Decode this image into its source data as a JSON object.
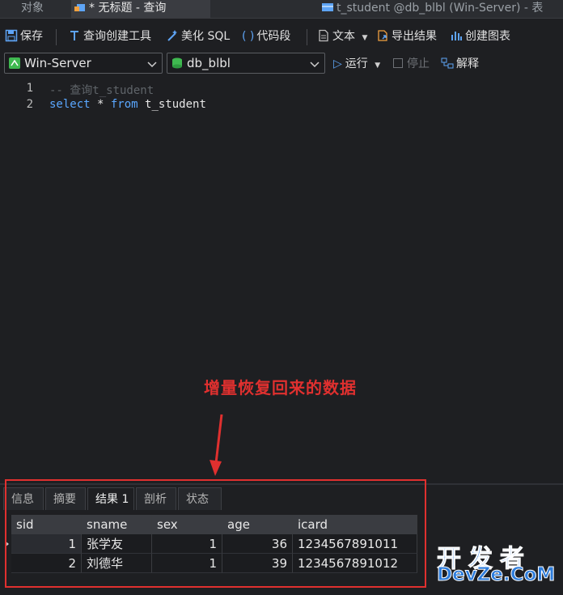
{
  "tabs": [
    {
      "label": "对象"
    },
    {
      "label": "* 无标题 - 查询"
    },
    {
      "label": "t_student @db_blbl (Win-Server) - 表"
    }
  ],
  "toolbar": {
    "save": "保存",
    "query_builder": "查询创建工具",
    "beautify_sql": "美化 SQL",
    "code_snippet": "代码段",
    "text": "文本",
    "export_result": "导出结果",
    "create_chart": "创建图表"
  },
  "toolbar2": {
    "connection": "Win-Server",
    "database": "db_blbl",
    "run": "运行",
    "stop": "停止",
    "explain": "解释"
  },
  "editor": {
    "lines": [
      {
        "no": "1",
        "comment": "-- 查询t_student"
      },
      {
        "no": "2",
        "kw1": "select",
        "star": " * ",
        "kw2": "from",
        "table": " t_student"
      }
    ]
  },
  "annotation": "增量恢复回来的数据",
  "result_tabs": [
    "信息",
    "摘要",
    "结果 1",
    "剖析",
    "状态"
  ],
  "grid": {
    "columns": [
      "sid",
      "sname",
      "sex",
      "age",
      "icard"
    ],
    "rows": [
      [
        "1",
        "张学友",
        "1",
        "36",
        "1234567891011"
      ],
      [
        "2",
        "刘德华",
        "1",
        "39",
        "1234567891012"
      ]
    ]
  },
  "watermark": {
    "line1": "开发者",
    "line2": "DevZe.CoM"
  },
  "colors": {
    "accent": "#3d8ee8",
    "annotation": "#e0302f",
    "keyword": "#5aa7ff",
    "comment": "#5f6469"
  }
}
